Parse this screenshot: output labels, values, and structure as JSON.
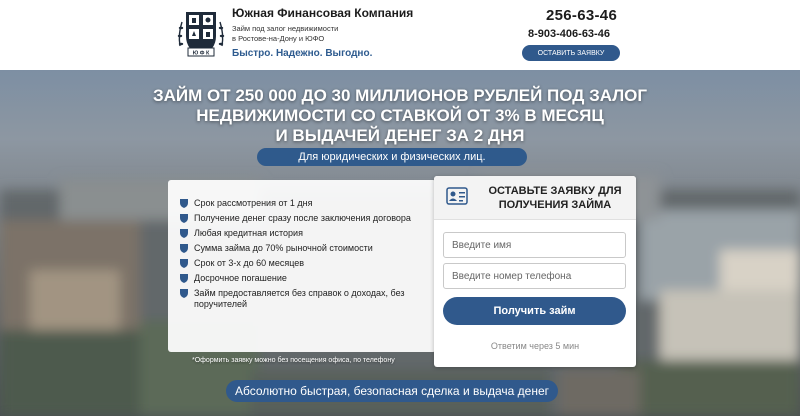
{
  "header": {
    "company_name": "Южная Финансовая Компания",
    "description_line1": "Займ под залог недвижимости",
    "description_line2": "в Ростове-на-Дону и ЮФО",
    "slogan": "Быстро. Надежно. Выгодно.",
    "logo_text": "Ю Ф К",
    "phone_main": "256-63-46",
    "phone_mobile": "8-903-406-63-46",
    "request_button": "ОСТАВИТЬ ЗАЯВКУ"
  },
  "hero": {
    "headline_line1": "Займ от 250 000 до 30 миллионов рублей под залог",
    "headline_line2": "недвижимости со ставкой от 3% в месяц",
    "headline_line3": "и выдачей денег за 2 дня",
    "audience": "Для юридических и физических лиц."
  },
  "benefits": [
    "Срок рассмотрения от 1 дня",
    "Получение денег сразу после заключения договора",
    "Любая кредитная история",
    "Сумма займа до 70% рыночной стоимости",
    "Срок от 3-х до 60 месяцев",
    "Досрочное погашение",
    "Займ предоставляется без справок о доходах, без поручителей"
  ],
  "footnote": "*Оформить заявку можно без посещения офиса, по телефону",
  "form": {
    "title_line1": "ОСТАВЬТЕ ЗАЯВКУ ДЛЯ",
    "title_line2": "ПОЛУЧЕНИЯ ЗАЙМА",
    "name_placeholder": "Введите имя",
    "phone_placeholder": "Введите номер телефона",
    "submit_label": "Получить займ",
    "reply_note": "Ответим через 5 мин"
  },
  "bottom_banner": "Абсолютно быстрая, безопасная сделка и выдача денег",
  "colors": {
    "accent": "#30598c",
    "slogan": "#2e5b8f",
    "logo_dark": "#1f2b3a"
  },
  "icons": {
    "bullet": "shield-icon",
    "form_header": "id-card-icon"
  }
}
